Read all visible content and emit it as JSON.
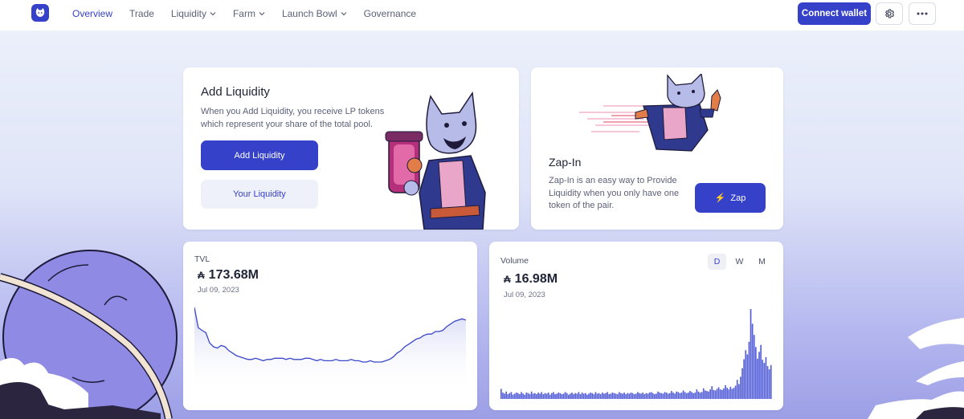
{
  "nav": {
    "links": [
      {
        "label": "Overview",
        "active": true,
        "dropdown": false
      },
      {
        "label": "Trade",
        "active": false,
        "dropdown": false
      },
      {
        "label": "Liquidity",
        "active": false,
        "dropdown": true
      },
      {
        "label": "Farm",
        "active": false,
        "dropdown": true
      },
      {
        "label": "Launch Bowl",
        "active": false,
        "dropdown": true
      },
      {
        "label": "Governance",
        "active": false,
        "dropdown": false
      }
    ],
    "connect_wallet_label": "Connect wallet",
    "settings_icon": "gear-icon",
    "more_icon": "more-horizontal-icon",
    "logo_icon": "cat-logo-icon"
  },
  "add_liquidity": {
    "title": "Add Liquidity",
    "description": "When you Add Liquidity, you receive LP tokens which represent your share of the total pool.",
    "primary_button": "Add Liquidity",
    "secondary_button": "Your Liquidity"
  },
  "zap_in": {
    "title": "Zap-In",
    "description": "Zap-In is an easy way to Provide Liquidity when you only have one token of the pair.",
    "button_label": "Zap",
    "button_icon": "lightning-icon"
  },
  "tvl": {
    "label": "TVL",
    "currency_symbol": "₳",
    "value": "173.68M",
    "date": "Jul 09, 2023"
  },
  "volume": {
    "label": "Volume",
    "currency_symbol": "₳",
    "value": "16.98M",
    "date": "Jul 09, 2023",
    "timeframes": [
      "D",
      "W",
      "M"
    ],
    "active_timeframe": "D"
  },
  "colors": {
    "accent": "#3541c9",
    "accent_light": "#eef0fa",
    "chart_line": "#3a47c9",
    "chart_bar": "#5560d8"
  },
  "chart_data": [
    {
      "type": "area",
      "title": "",
      "series": [
        {
          "values": [
            188,
            172,
            170,
            168,
            160,
            157,
            156,
            158,
            157,
            154,
            152,
            150,
            149,
            148,
            147,
            147,
            148,
            147,
            146,
            147,
            147,
            148,
            148,
            148,
            147,
            148,
            147,
            147,
            147,
            148,
            148,
            147,
            146,
            147,
            146,
            146,
            146,
            147,
            146,
            146,
            146,
            147,
            146,
            146,
            145,
            145,
            146,
            145,
            145,
            145,
            146,
            147,
            149,
            152,
            154,
            157,
            159,
            161,
            163,
            164,
            166,
            167,
            167,
            169,
            169,
            170,
            173,
            175,
            177,
            178,
            179,
            178
          ]
        }
      ]
    },
    {
      "type": "bar",
      "title": "",
      "series": [
        {
          "values": [
            1.9,
            1.2,
            1.0,
            1.4,
            0.9,
            1.1,
            1.3,
            0.8,
            1.0,
            1.2,
            1.1,
            0.9,
            1.3,
            1.0,
            0.8,
            1.2,
            1.1,
            0.9,
            1.4,
            1.0,
            1.1,
            0.9,
            1.2,
            1.0,
            1.3,
            0.9,
            1.1,
            1.0,
            1.2,
            0.8,
            1.1,
            1.3,
            0.9,
            1.0,
            1.2,
            1.1,
            0.9,
            1.0,
            1.3,
            1.1,
            0.8,
            1.0,
            1.2,
            0.9,
            1.1,
            1.0,
            1.3,
            0.9,
            1.2,
            1.0,
            1.1,
            0.8,
            1.0,
            1.2,
            1.1,
            0.9,
            1.3,
            1.0,
            1.1,
            0.9,
            1.2,
            1.0,
            1.1,
            1.3,
            0.9,
            1.0,
            1.2,
            1.1,
            1.0,
            0.9,
            1.3,
            1.1,
            1.0,
            1.2,
            0.9,
            1.1,
            1.0,
            1.2,
            1.1,
            0.9,
            1.0,
            1.3,
            1.1,
            1.0,
            1.2,
            0.9,
            1.1,
            1.0,
            1.2,
            1.3,
            1.1,
            0.9,
            1.0,
            1.4,
            1.2,
            1.1,
            1.0,
            1.3,
            1.2,
            1.0,
            1.1,
            1.5,
            1.2,
            1.0,
            1.4,
            1.3,
            1.1,
            1.2,
            1.6,
            1.3,
            1.1,
            1.2,
            1.5,
            1.3,
            1.1,
            1.2,
            1.8,
            1.4,
            1.2,
            1.3,
            2.0,
            1.6,
            1.5,
            1.4,
            1.8,
            2.4,
            1.7,
            1.6,
            1.9,
            2.2,
            1.8,
            1.7,
            2.0,
            2.6,
            2.1,
            1.8,
            2.3,
            1.9,
            2.1,
            2.5,
            3.6,
            2.8,
            4.2,
            5.8,
            7.5,
            9.2,
            8.4,
            10.8,
            16.98,
            14.2,
            12.1,
            9.8,
            7.6,
            8.9,
            10.2,
            7.4,
            6.8,
            7.9,
            6.2,
            5.6,
            6.4
          ]
        }
      ]
    }
  ]
}
